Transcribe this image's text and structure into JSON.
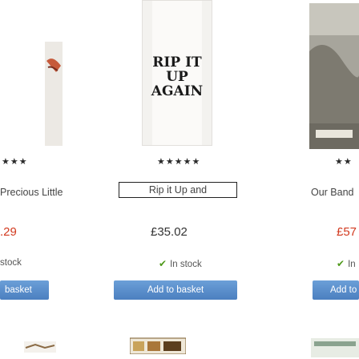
{
  "products": [
    {
      "stars": "★★★",
      "title": "Precious Little",
      "price": ".29",
      "stock": "stock",
      "button": "basket"
    },
    {
      "cover_text": [
        "RIP IT",
        "UP",
        "AGAIN"
      ],
      "stars": "★★★★★",
      "title": "Rip it Up and",
      "price": "£35.02",
      "stock": "In stock",
      "button": "Add to basket"
    },
    {
      "stars": "★★",
      "title": "Our Band",
      "price": "£57",
      "stock": "In",
      "button": "Add to"
    }
  ],
  "colors": {
    "price": "#d23a1f",
    "stock_tick": "#4f9a1b",
    "button": "#5a8fcf"
  },
  "icons": {
    "rating": "star-icon",
    "in_stock": "check-icon"
  }
}
